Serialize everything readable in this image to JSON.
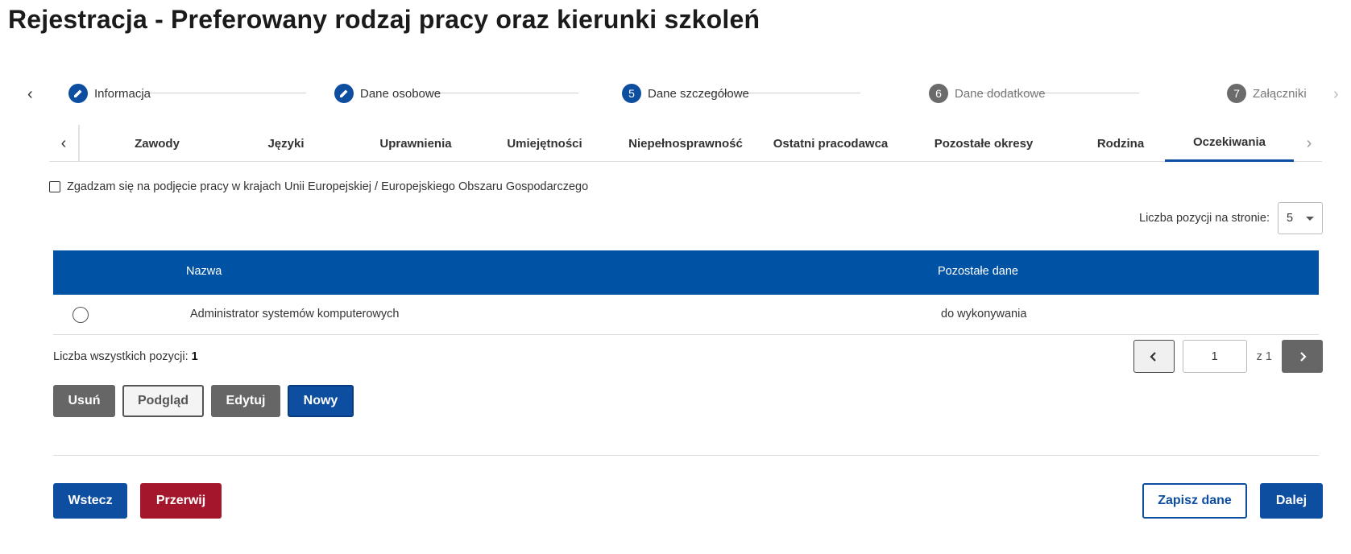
{
  "page": {
    "title": "Rejestracja - Preferowany rodzaj pracy oraz kierunki szkoleń"
  },
  "stepper": {
    "prev_icon": "chevron-left-icon",
    "next_icon": "chevron-right-icon",
    "steps": [
      {
        "number": "",
        "label": "Informacja",
        "state": "done",
        "icon": "pencil-icon"
      },
      {
        "number": "",
        "label": "Dane osobowe",
        "state": "done",
        "icon": "pencil-icon"
      },
      {
        "number": "5",
        "label": "Dane szczegółowe",
        "state": "active"
      },
      {
        "number": "6",
        "label": "Dane dodatkowe",
        "state": "todo"
      },
      {
        "number": "7",
        "label": "Załączniki",
        "state": "todo"
      }
    ]
  },
  "tabs": {
    "items": [
      {
        "label": "Zawody"
      },
      {
        "label": "Języki"
      },
      {
        "label": "Uprawnienia"
      },
      {
        "label": "Umiejętności"
      },
      {
        "label": "Niepełnosprawność"
      },
      {
        "label": "Ostatni pracodawca"
      },
      {
        "label": "Pozostałe okresy"
      },
      {
        "label": "Rodzina"
      },
      {
        "label": "Oczekiwania",
        "active": true
      }
    ]
  },
  "consent": {
    "label": "Zgadzam się na podjęcie pracy w krajach Unii Europejskiej / Europejskiego Obszaru Gospodarczego",
    "checked": false
  },
  "per_page": {
    "label": "Liczba pozycji na stronie:",
    "value": "5"
  },
  "table": {
    "headers": {
      "name": "Nazwa",
      "other": "Pozostałe dane"
    },
    "rows": [
      {
        "name": "Administrator systemów komputerowych",
        "other": "do wykonywania",
        "selected": false
      }
    ]
  },
  "total": {
    "label": "Liczba wszystkich pozycji:",
    "value": "1"
  },
  "pagination": {
    "current": "1",
    "of_label": "z 1"
  },
  "actions": {
    "delete": "Usuń",
    "preview": "Podgląd",
    "edit": "Edytuj",
    "new": "Nowy"
  },
  "footer": {
    "back": "Wstecz",
    "abort": "Przerwij",
    "save": "Zapisz dane",
    "next": "Dalej"
  },
  "colors": {
    "primary": "#0d4ea1",
    "table_header": "#0052a5",
    "danger": "#a3162b",
    "gray": "#666666"
  }
}
